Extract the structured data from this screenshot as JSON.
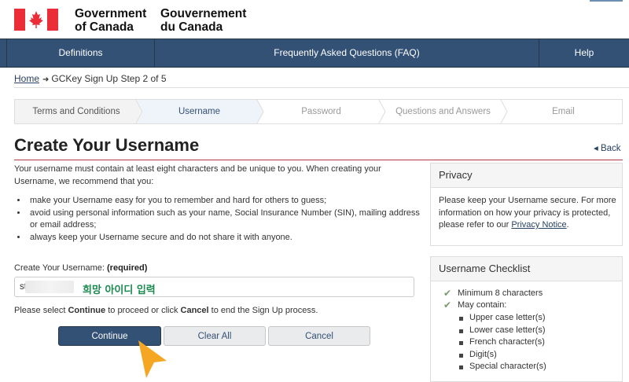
{
  "header": {
    "wordmark_en": [
      "Government",
      "of Canada"
    ],
    "wordmark_fr": [
      "Gouvernement",
      "du Canada"
    ],
    "flag_colors": {
      "red": "#eb2d37",
      "white": "#ffffff"
    }
  },
  "nav": {
    "items": [
      {
        "label": "Definitions"
      },
      {
        "label": "Frequently Asked Questions (FAQ)"
      },
      {
        "label": "Help"
      }
    ],
    "bg_color": "#335075"
  },
  "breadcrumb": {
    "home": "Home",
    "current": "GCKey Sign Up Step 2 of 5"
  },
  "steps": [
    {
      "label": "Terms and Conditions",
      "state": "completed"
    },
    {
      "label": "Username",
      "state": "current"
    },
    {
      "label": "Password",
      "state": "upcoming"
    },
    {
      "label": "Questions and Answers",
      "state": "upcoming"
    },
    {
      "label": "Email",
      "state": "upcoming"
    }
  ],
  "main": {
    "title": "Create Your Username",
    "back_label": "Back",
    "intro": "Your username must contain at least eight characters and be unique to you. When creating your Username, we recommend that you:",
    "recommendations": [
      "make your Username easy for you to remember and hard for others to guess;",
      "avoid using personal information such as your name, Social Insurance Number (SIN), mailing address or email address;",
      "always keep your Username secure and do not share it with anyone."
    ],
    "field_label": "Create Your Username:",
    "field_required": "(required)",
    "field_value": "st",
    "overlay_hint": "희망 아이디 입력",
    "proceed_pre": "Please select ",
    "proceed_continue": "Continue",
    "proceed_mid": " to proceed or click ",
    "proceed_cancel": "Cancel",
    "proceed_post": " to end the Sign Up process.",
    "buttons": {
      "continue": "Continue",
      "clear_all": "Clear All",
      "cancel": "Cancel"
    }
  },
  "privacy_panel": {
    "title": "Privacy",
    "body": "Please keep your Username secure. For more information on how your privacy is protected, please refer to our ",
    "link": "Privacy Notice",
    "body_end": "."
  },
  "checklist_panel": {
    "title": "Username Checklist",
    "items": [
      "Minimum 8 characters",
      "May contain:"
    ],
    "subitems": [
      "Upper case letter(s)",
      "Lower case letter(s)",
      "French character(s)",
      "Digit(s)",
      "Special character(s)"
    ]
  },
  "cursor_color": "#f5a623"
}
